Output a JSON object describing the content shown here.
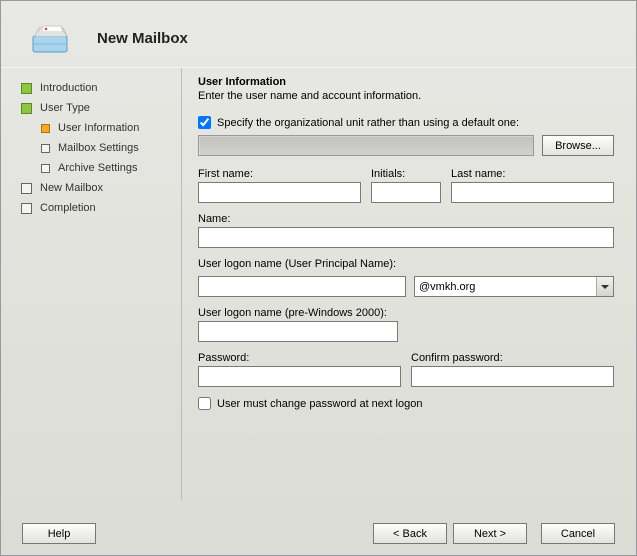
{
  "header": {
    "title": "New Mailbox"
  },
  "sidebar": {
    "items": [
      {
        "label": "Introduction",
        "state": "done",
        "sub": false
      },
      {
        "label": "User Type",
        "state": "done",
        "sub": false
      },
      {
        "label": "User Information",
        "state": "curr",
        "sub": true
      },
      {
        "label": "Mailbox Settings",
        "state": "pending",
        "sub": true
      },
      {
        "label": "Archive Settings",
        "state": "pending",
        "sub": true
      },
      {
        "label": "New Mailbox",
        "state": "pending",
        "sub": false
      },
      {
        "label": "Completion",
        "state": "pending",
        "sub": false
      }
    ]
  },
  "content": {
    "section_title": "User Information",
    "section_desc": "Enter the user name and account information.",
    "specify_ou_label": "Specify the organizational unit rather than using a default one:",
    "specify_ou_checked": true,
    "ou_value": "",
    "browse_label": "Browse...",
    "first_name_label": "First name:",
    "first_name": "",
    "initials_label": "Initials:",
    "initials": "",
    "last_name_label": "Last name:",
    "last_name": "",
    "name_label": "Name:",
    "name": "",
    "upn_label": "User logon name (User Principal Name):",
    "upn_value": "",
    "upn_domain": "@vmkh.org",
    "prewin_label": "User logon name (pre-Windows 2000):",
    "prewin_value": "",
    "password_label": "Password:",
    "password": "",
    "confirm_label": "Confirm password:",
    "confirm": "",
    "must_change_label": "User must change password at next logon",
    "must_change_checked": false
  },
  "footer": {
    "help": "Help",
    "back": "< Back",
    "next": "Next >",
    "cancel": "Cancel"
  }
}
